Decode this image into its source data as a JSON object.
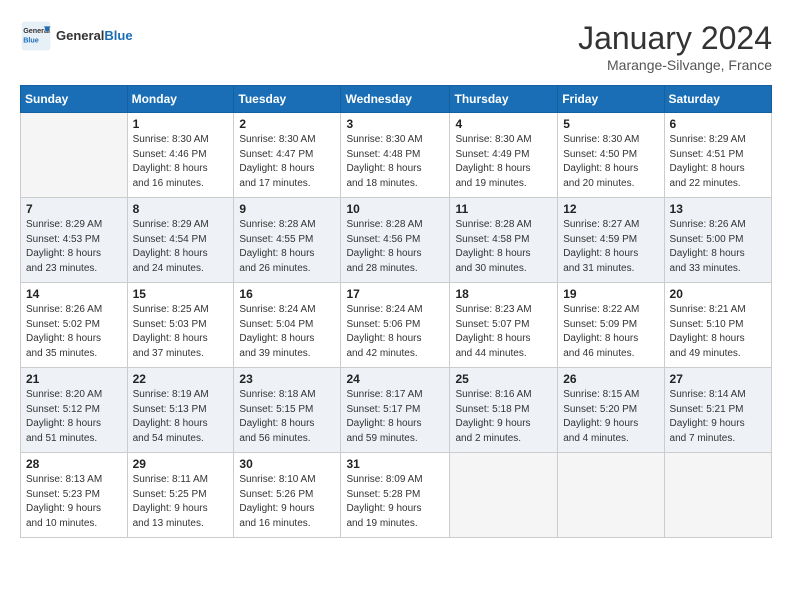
{
  "logo": {
    "text_general": "General",
    "text_blue": "Blue"
  },
  "title": "January 2024",
  "location": "Marange-Silvange, France",
  "days_of_week": [
    "Sunday",
    "Monday",
    "Tuesday",
    "Wednesday",
    "Thursday",
    "Friday",
    "Saturday"
  ],
  "weeks": [
    [
      {
        "day": "",
        "info": ""
      },
      {
        "day": "1",
        "info": "Sunrise: 8:30 AM\nSunset: 4:46 PM\nDaylight: 8 hours\nand 16 minutes."
      },
      {
        "day": "2",
        "info": "Sunrise: 8:30 AM\nSunset: 4:47 PM\nDaylight: 8 hours\nand 17 minutes."
      },
      {
        "day": "3",
        "info": "Sunrise: 8:30 AM\nSunset: 4:48 PM\nDaylight: 8 hours\nand 18 minutes."
      },
      {
        "day": "4",
        "info": "Sunrise: 8:30 AM\nSunset: 4:49 PM\nDaylight: 8 hours\nand 19 minutes."
      },
      {
        "day": "5",
        "info": "Sunrise: 8:30 AM\nSunset: 4:50 PM\nDaylight: 8 hours\nand 20 minutes."
      },
      {
        "day": "6",
        "info": "Sunrise: 8:29 AM\nSunset: 4:51 PM\nDaylight: 8 hours\nand 22 minutes."
      }
    ],
    [
      {
        "day": "7",
        "info": "Sunrise: 8:29 AM\nSunset: 4:53 PM\nDaylight: 8 hours\nand 23 minutes."
      },
      {
        "day": "8",
        "info": "Sunrise: 8:29 AM\nSunset: 4:54 PM\nDaylight: 8 hours\nand 24 minutes."
      },
      {
        "day": "9",
        "info": "Sunrise: 8:28 AM\nSunset: 4:55 PM\nDaylight: 8 hours\nand 26 minutes."
      },
      {
        "day": "10",
        "info": "Sunrise: 8:28 AM\nSunset: 4:56 PM\nDaylight: 8 hours\nand 28 minutes."
      },
      {
        "day": "11",
        "info": "Sunrise: 8:28 AM\nSunset: 4:58 PM\nDaylight: 8 hours\nand 30 minutes."
      },
      {
        "day": "12",
        "info": "Sunrise: 8:27 AM\nSunset: 4:59 PM\nDaylight: 8 hours\nand 31 minutes."
      },
      {
        "day": "13",
        "info": "Sunrise: 8:26 AM\nSunset: 5:00 PM\nDaylight: 8 hours\nand 33 minutes."
      }
    ],
    [
      {
        "day": "14",
        "info": "Sunrise: 8:26 AM\nSunset: 5:02 PM\nDaylight: 8 hours\nand 35 minutes."
      },
      {
        "day": "15",
        "info": "Sunrise: 8:25 AM\nSunset: 5:03 PM\nDaylight: 8 hours\nand 37 minutes."
      },
      {
        "day": "16",
        "info": "Sunrise: 8:24 AM\nSunset: 5:04 PM\nDaylight: 8 hours\nand 39 minutes."
      },
      {
        "day": "17",
        "info": "Sunrise: 8:24 AM\nSunset: 5:06 PM\nDaylight: 8 hours\nand 42 minutes."
      },
      {
        "day": "18",
        "info": "Sunrise: 8:23 AM\nSunset: 5:07 PM\nDaylight: 8 hours\nand 44 minutes."
      },
      {
        "day": "19",
        "info": "Sunrise: 8:22 AM\nSunset: 5:09 PM\nDaylight: 8 hours\nand 46 minutes."
      },
      {
        "day": "20",
        "info": "Sunrise: 8:21 AM\nSunset: 5:10 PM\nDaylight: 8 hours\nand 49 minutes."
      }
    ],
    [
      {
        "day": "21",
        "info": "Sunrise: 8:20 AM\nSunset: 5:12 PM\nDaylight: 8 hours\nand 51 minutes."
      },
      {
        "day": "22",
        "info": "Sunrise: 8:19 AM\nSunset: 5:13 PM\nDaylight: 8 hours\nand 54 minutes."
      },
      {
        "day": "23",
        "info": "Sunrise: 8:18 AM\nSunset: 5:15 PM\nDaylight: 8 hours\nand 56 minutes."
      },
      {
        "day": "24",
        "info": "Sunrise: 8:17 AM\nSunset: 5:17 PM\nDaylight: 8 hours\nand 59 minutes."
      },
      {
        "day": "25",
        "info": "Sunrise: 8:16 AM\nSunset: 5:18 PM\nDaylight: 9 hours\nand 2 minutes."
      },
      {
        "day": "26",
        "info": "Sunrise: 8:15 AM\nSunset: 5:20 PM\nDaylight: 9 hours\nand 4 minutes."
      },
      {
        "day": "27",
        "info": "Sunrise: 8:14 AM\nSunset: 5:21 PM\nDaylight: 9 hours\nand 7 minutes."
      }
    ],
    [
      {
        "day": "28",
        "info": "Sunrise: 8:13 AM\nSunset: 5:23 PM\nDaylight: 9 hours\nand 10 minutes."
      },
      {
        "day": "29",
        "info": "Sunrise: 8:11 AM\nSunset: 5:25 PM\nDaylight: 9 hours\nand 13 minutes."
      },
      {
        "day": "30",
        "info": "Sunrise: 8:10 AM\nSunset: 5:26 PM\nDaylight: 9 hours\nand 16 minutes."
      },
      {
        "day": "31",
        "info": "Sunrise: 8:09 AM\nSunset: 5:28 PM\nDaylight: 9 hours\nand 19 minutes."
      },
      {
        "day": "",
        "info": ""
      },
      {
        "day": "",
        "info": ""
      },
      {
        "day": "",
        "info": ""
      }
    ]
  ],
  "row_colors": [
    "#ffffff",
    "#eef2f7",
    "#ffffff",
    "#eef2f7",
    "#ffffff"
  ]
}
